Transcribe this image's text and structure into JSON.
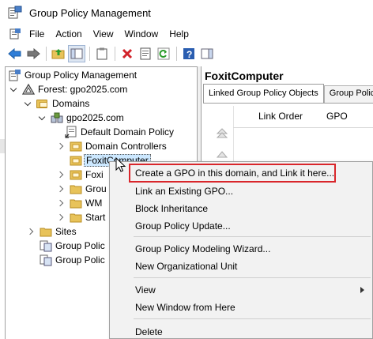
{
  "window": {
    "title": "Group Policy Management"
  },
  "menu": [
    "File",
    "Action",
    "View",
    "Window",
    "Help"
  ],
  "tree": {
    "root": "Group Policy Management",
    "forest": "Forest: gpo2025.com",
    "domains": "Domains",
    "domain": "gpo2025.com",
    "default_policy": "Default Domain Policy",
    "domain_controllers": "Domain Controllers",
    "selected_ou": "FoxitComputer",
    "ou_foxit2": "Foxi",
    "ou_group": "Grou",
    "ou_wm": "WM",
    "ou_start": "Start",
    "sites": "Sites",
    "gp_modeling": "Group Polic",
    "gp_results": "Group Polic"
  },
  "right_pane": {
    "title": "FoxitComputer",
    "tabs": [
      "Linked Group Policy Objects",
      "Group Policy"
    ],
    "columns": [
      "Link Order",
      "GPO"
    ]
  },
  "context_menu": {
    "items": [
      "Create a GPO in this domain, and Link it here...",
      "Link an Existing GPO...",
      "Block Inheritance",
      "Group Policy Update...",
      "Group Policy Modeling Wizard...",
      "New Organizational Unit",
      "View",
      "New Window from Here",
      "Delete"
    ]
  },
  "colors": {
    "highlight": "#d9262b",
    "selection": "#cce8ff"
  }
}
